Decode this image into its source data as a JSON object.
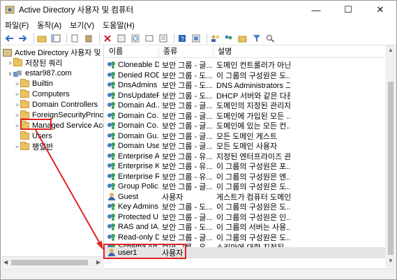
{
  "window": {
    "title": "Active Directory 사용자 및 컴퓨터"
  },
  "menu": [
    "파일(F)",
    "동작(A)",
    "보기(V)",
    "도움말(H)"
  ],
  "tree": {
    "root": "Active Directory 사용자 및 컴퓨터",
    "saved_queries": "저장된 쿼리",
    "domain": "estar987.com",
    "containers": [
      "Builtin",
      "Computers",
      "Domain Controllers",
      "ForeignSecurityPrincipal",
      "Managed Service Accou",
      "Users",
      "팽일반"
    ]
  },
  "list": {
    "headers": {
      "name": "이름",
      "type": "종류",
      "desc": "설명"
    },
    "rows": [
      {
        "name": "Cloneable D...",
        "type": "보안 그룹 - 글...",
        "desc": "도메인 컨트롤러가 아닌..."
      },
      {
        "name": "Denied ROD...",
        "type": "보안 그룹 - 도...",
        "desc": "이 그룹의 구성원은 도..."
      },
      {
        "name": "DnsAdmins",
        "type": "보안 그룹 - 도...",
        "desc": "DNS Administrators 그룹"
      },
      {
        "name": "DnsUpdateP...",
        "type": "보안 그룹 - 도...",
        "desc": "DHCP 서버와 같은 다른..."
      },
      {
        "name": "Domain Ad...",
        "type": "보안 그룹 - 글...",
        "desc": "도메인의 지정된 관리자"
      },
      {
        "name": "Domain Co...",
        "type": "보안 그룹 - 글...",
        "desc": "도메인에 가입된 모든 ..."
      },
      {
        "name": "Domain Co...",
        "type": "보안 그룹 - 글...",
        "desc": "도메인에 있는 모든 컨..."
      },
      {
        "name": "Domain Gu...",
        "type": "보안 그룹 - 글...",
        "desc": "모든 도메인 게스트"
      },
      {
        "name": "Domain Users",
        "type": "보안 그룹 - 글...",
        "desc": "모든 도메인 사용자"
      },
      {
        "name": "Enterprise A...",
        "type": "보안 그룹 - 유...",
        "desc": "지정된 엔터프라이즈 관..."
      },
      {
        "name": "Enterprise K...",
        "type": "보안 그룹 - 유...",
        "desc": "이 그룹의 구성원은 포..."
      },
      {
        "name": "Enterprise R...",
        "type": "보안 그룹 - 유...",
        "desc": "이 그룹의 구성원은 엔..."
      },
      {
        "name": "Group Polic...",
        "type": "보안 그룹 - 글...",
        "desc": "이 그룹의 구성원은 도..."
      },
      {
        "name": "Guest",
        "type": "사용자",
        "desc": "게스트가 컴퓨터 도메인..."
      },
      {
        "name": "Key Admins",
        "type": "보안 그룹 - 도...",
        "desc": "이 그룹의 구성원은 도..."
      },
      {
        "name": "Protected U...",
        "type": "보안 그룹 - 글...",
        "desc": "이 그룹의 구성원은 인..."
      },
      {
        "name": "RAS and IA...",
        "type": "보안 그룹 - 도...",
        "desc": "이 그룹의 서버는 사용..."
      },
      {
        "name": "Read-only D...",
        "type": "보안 그룹 - 글...",
        "desc": "이 그룹의 구성원은 도..."
      },
      {
        "name": "Schema Ad...",
        "type": "보안 그룹 - 유...",
        "desc": "스키마에 대한 지정된 ..."
      },
      {
        "name": "user1",
        "type": "사용자",
        "desc": ""
      }
    ]
  },
  "colors": {
    "highlight": "#e22222",
    "selected_row": "#e5e5e5"
  }
}
